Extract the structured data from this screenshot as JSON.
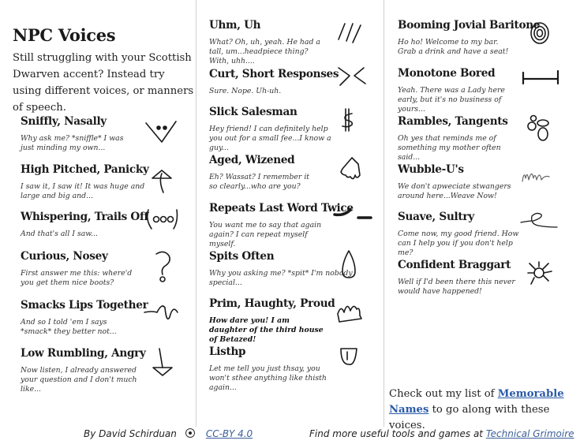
{
  "document": {
    "title": "NPC Voices",
    "intro": "Still struggling with your Scottish Dwarven accent? Instead try using different voices, or manners of speech."
  },
  "voices": [
    {
      "name": "Sniffly, Nasally",
      "quote": "Why ask me? *sniffle* I was just minding my own...",
      "icon": "nose-sniffle-icon"
    },
    {
      "name": "High Pitched, Panicky",
      "quote": "I saw it, I saw it! It was huge and large and big and...",
      "icon": "up-arrow-icon"
    },
    {
      "name": "Whispering, Trails Off",
      "quote": "And that's all I saw...",
      "icon": "ellipsis-parentheses-icon"
    },
    {
      "name": "Curious, Nosey",
      "quote": "First answer me this: where'd you get them nice boots?",
      "icon": "question-mark-icon"
    },
    {
      "name": "Smacks Lips Together",
      "quote": "And so I told 'em I says *smack* they better not...",
      "icon": "squiggle-icon"
    },
    {
      "name": "Low Rumbling, Angry",
      "quote": "Now listen, I already answered your question and I don't much like...",
      "icon": "down-arrow-icon"
    },
    {
      "name": "Uhm, Uh",
      "quote": "What? Oh, uh, yeah. He had a tall, um...headpiece thing? With, uhh....",
      "icon": "slashes-icon"
    },
    {
      "name": "Curt, Short Responses",
      "quote": "Sure. Nope. Uh-uh.",
      "icon": "angle-brackets-icon"
    },
    {
      "name": "Slick Salesman",
      "quote": "Hey friend! I can definitely help you out for a small fee...I know a guy...",
      "icon": "dollar-sign-icon"
    },
    {
      "name": "Aged, Wizened",
      "quote": "Eh? Wassat? I remember it so clearly...who are you?",
      "icon": "wrinkled-hand-icon"
    },
    {
      "name": "Repeats Last Word Twice",
      "quote": "You want me to say that again again? I can repeat myself myself.",
      "icon": "double-dash-icon"
    },
    {
      "name": "Spits Often",
      "quote": "Why you asking me? *spit* I'm nobody special...",
      "icon": "droplet-icon"
    },
    {
      "name": "Prim, Haughty, Proud",
      "quote": "How dare you! I am daughter of the third house of Betazed!",
      "icon": "crown-icon"
    },
    {
      "name": "Listhp",
      "quote": "Let me tell you just thsay, you won't sthee anything like thisth again...",
      "icon": "tongue-icon"
    },
    {
      "name": "Booming Jovial Baritone",
      "quote": "Ho ho! Welcome to my bar. Grab a drink and have a seat!",
      "icon": "concentric-circles-icon"
    },
    {
      "name": "Monotone Bored",
      "quote": "Yeah. There was a Lady here early, but it's no business of yours...",
      "icon": "flat-line-icon"
    },
    {
      "name": "Rambles, Tangents",
      "quote": "Oh yes that reminds me of something my mother often said...",
      "icon": "bubbles-icon"
    },
    {
      "name": "Wubble-U's",
      "quote": "We don't apweciate stwangers around here...Weave Now!",
      "icon": "wobbly-line-icon"
    },
    {
      "name": "Suave, Sultry",
      "quote": "Come now, my good friend. How can I help you if you don't help me?",
      "icon": "loop-line-icon"
    },
    {
      "name": "Confident Braggart",
      "quote": "Well if I'd been there this never would have happened!",
      "icon": "sun-burst-icon"
    }
  ],
  "cta": {
    "prefix": "Check out my list of ",
    "link": "Memorable Names",
    "suffix": " to go along with these voices."
  },
  "footer": {
    "author": "By David Schirduan",
    "license": "CC-BY 4.0",
    "more_prefix": "Find more useful tools and games at ",
    "more_link": "Technical Grimoire"
  },
  "colors": {
    "link": "#2a5aa8",
    "divider": "#d0d0d0",
    "text": "#1a1a1a"
  }
}
